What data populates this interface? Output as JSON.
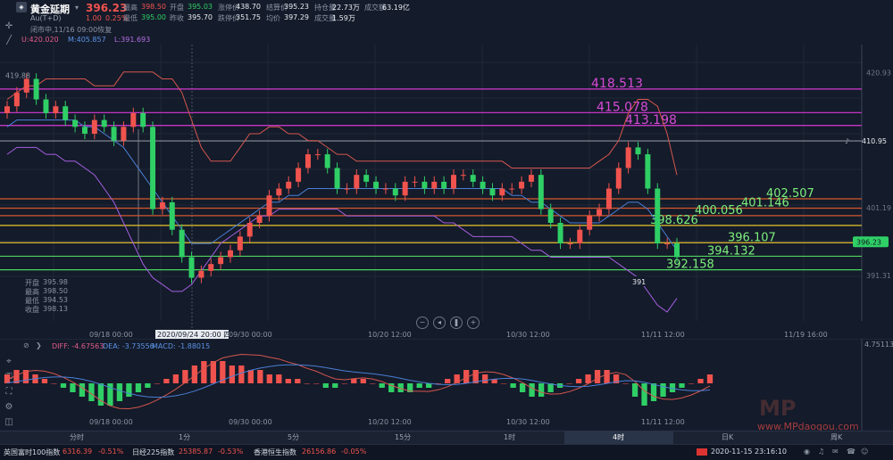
{
  "header": {
    "symbol_name": "黄金延期",
    "symbol_code": "Au(T+D)",
    "price": "396.23",
    "change": "1.00",
    "change_pct": "0.25%",
    "stats": [
      {
        "label": "最高",
        "value": "398.50",
        "color": "red"
      },
      {
        "label": "开盘",
        "value": "395.03",
        "color": "green"
      },
      {
        "label": "涨停价",
        "value": "438.70",
        "color": "white"
      },
      {
        "label": "结算价",
        "value": "395.23",
        "color": "white"
      },
      {
        "label": "持仓量",
        "value": "22.73万",
        "color": "white"
      },
      {
        "label": "成交额",
        "value": "63.19亿",
        "color": "white"
      },
      {
        "label": "最低",
        "value": "395.00",
        "color": "green"
      },
      {
        "label": "昨收",
        "value": "395.70",
        "color": "white"
      },
      {
        "label": "跌停价",
        "value": "351.75",
        "color": "white"
      },
      {
        "label": "均价",
        "value": "397.29",
        "color": "white"
      },
      {
        "label": "成交量",
        "value": "1.59万",
        "color": "white"
      }
    ],
    "status_line": "闭市中,11/16 09:00恢复",
    "boll": {
      "up": "U:420.020",
      "mid": "M:405.857",
      "low": "L:391.693"
    }
  },
  "ohlc_panel": [
    {
      "label": "开盘",
      "value": "395.98"
    },
    {
      "label": "最高",
      "value": "398.50"
    },
    {
      "label": "最低",
      "value": "394.53"
    },
    {
      "label": "收盘",
      "value": "398.13"
    }
  ],
  "chart_data": [
    {
      "type": "candlestick",
      "title": "",
      "ylim": [
        386,
        425
      ],
      "price_axis_labels": [
        "420.93",
        "410.95",
        "401.19",
        "396.23",
        "391.31"
      ],
      "left_axis_label": "419.88",
      "x_ticks": [
        "09/18 00:00",
        "2020/09/24 20:00 四",
        "09/30 00:00",
        "10/20 12:00",
        "10/30 12:00",
        "11/11 12:00",
        "11/19 16:00"
      ],
      "current_price": "396.23",
      "low_marker": "391",
      "levels": [
        {
          "value": 418.513,
          "label": "418.513",
          "color": "#d63ad6"
        },
        {
          "value": 415.078,
          "label": "415.078",
          "color": "#d63ad6"
        },
        {
          "value": 413.198,
          "label": "413.198",
          "color": "#d63ad6"
        },
        {
          "value": 410.95,
          "label": "",
          "color": "#8a8f99"
        },
        {
          "value": 402.507,
          "label": "402.507",
          "color": "#d2592e"
        },
        {
          "value": 401.146,
          "label": "401.146",
          "color": "#d2592e"
        },
        {
          "value": 400.056,
          "label": "400.056",
          "color": "#d2592e"
        },
        {
          "value": 398.626,
          "label": "398.626",
          "color": "#e6c42e"
        },
        {
          "value": 396.107,
          "label": "396.107",
          "color": "#e6c42e"
        },
        {
          "value": 394.132,
          "label": "394.132",
          "color": "#4cd460"
        },
        {
          "value": 392.158,
          "label": "392.158",
          "color": "#4cd460"
        }
      ],
      "series": [
        {
          "name": "close",
          "values": [
            416,
            418,
            420,
            417,
            415,
            416,
            414,
            413,
            412,
            414,
            413,
            411,
            413,
            415,
            413,
            401,
            402,
            398,
            394,
            391,
            392,
            393,
            394,
            395,
            397,
            399,
            400,
            403,
            404,
            405,
            407,
            409,
            409,
            407,
            404,
            404,
            406,
            405,
            404,
            404,
            403,
            405,
            405,
            404,
            405,
            404,
            406,
            406,
            405,
            404,
            403,
            404,
            404,
            405,
            406,
            401,
            399,
            396,
            396,
            398,
            400,
            401,
            404,
            407,
            410,
            409,
            404,
            396,
            396,
            394
          ]
        },
        {
          "name": "boll_upper",
          "values": [
            417,
            418,
            419,
            419,
            420,
            420,
            420,
            420,
            420,
            419,
            419,
            419,
            421,
            421,
            421,
            421,
            420,
            420,
            418,
            414,
            410,
            408,
            408,
            408,
            410,
            412,
            412,
            413,
            413,
            412,
            412,
            411,
            411,
            410,
            409,
            409,
            408,
            408,
            408,
            408,
            408,
            408,
            408,
            408,
            408,
            408,
            408,
            408,
            408,
            408,
            408,
            408,
            407,
            407,
            407,
            407,
            407,
            407,
            407,
            407,
            407,
            408,
            409,
            411,
            415,
            417,
            417,
            416,
            412,
            406
          ]
        },
        {
          "name": "boll_mid",
          "values": [
            413,
            414,
            414,
            414,
            414,
            414,
            414,
            414,
            413,
            413,
            412,
            411,
            410,
            408,
            406,
            404,
            402,
            400,
            398,
            396,
            396,
            396,
            397,
            398,
            399,
            400,
            401,
            402,
            402,
            403,
            403,
            404,
            404,
            404,
            404,
            404,
            404,
            404,
            404,
            404,
            404,
            404,
            404,
            404,
            404,
            404,
            404,
            404,
            404,
            404,
            404,
            404,
            403,
            403,
            402,
            402,
            401,
            400,
            399,
            399,
            399,
            399,
            400,
            401,
            402,
            402,
            401,
            399,
            397,
            395
          ]
        },
        {
          "name": "boll_lower",
          "values": [
            409,
            410,
            410,
            410,
            409,
            409,
            408,
            408,
            407,
            406,
            404,
            402,
            399,
            396,
            393,
            391,
            390,
            389,
            389,
            390,
            392,
            394,
            396,
            397,
            398,
            399,
            400,
            400,
            401,
            401,
            401,
            401,
            401,
            401,
            401,
            400,
            400,
            400,
            400,
            400,
            400,
            400,
            400,
            400,
            400,
            399,
            399,
            398,
            397,
            397,
            397,
            397,
            397,
            396,
            395,
            395,
            394,
            394,
            394,
            394,
            394,
            394,
            394,
            393,
            392,
            391,
            389,
            387,
            386,
            388
          ]
        }
      ]
    },
    {
      "type": "bar",
      "title": "",
      "indicator": "MACD",
      "legend": {
        "diff": "DIFF: -4.67563",
        "dea": "DEA: -3.73556",
        "macd": "MACD: -1.88015"
      },
      "axis_label": "4.75113",
      "x_ticks": [
        "09/18 00:00",
        "09/30 00:00",
        "10/20 12:00",
        "10/30 12:00",
        "11/11 12:00"
      ],
      "values": [
        2,
        3,
        3,
        2,
        1,
        0,
        -1,
        -2,
        -3,
        -4,
        -5,
        -5,
        -4,
        -3,
        -2,
        -1,
        0,
        1,
        2,
        3,
        4,
        5,
        5,
        5,
        4,
        4,
        3,
        3,
        2,
        2,
        1,
        1,
        0,
        0,
        -1,
        -1,
        0,
        1,
        1,
        0,
        -1,
        -2,
        -2,
        -2,
        -1,
        -1,
        0,
        1,
        2,
        3,
        3,
        2,
        1,
        0,
        -1,
        -2,
        -3,
        -3,
        -2,
        -1,
        0,
        1,
        2,
        3,
        3,
        2,
        0,
        -3,
        -5,
        -4,
        -3,
        -2,
        -1,
        0,
        1,
        2
      ]
    }
  ],
  "tabs": [
    "分时",
    "1分",
    "5分",
    "15分",
    "1时",
    "4时",
    "日K",
    "周K"
  ],
  "ticker": [
    {
      "name": "英国富时100指数",
      "value": "6316.39",
      "pct": "-0.51%",
      "color": "red"
    },
    {
      "name": "日经225指数",
      "value": "25385.87",
      "pct": "-0.53%",
      "color": "red"
    },
    {
      "name": "香港恒生指数",
      "value": "26156.86",
      "pct": "-0.05%",
      "color": "red"
    }
  ],
  "datetime": "2020-11-15 23:16:10",
  "watermark": {
    "brand": "MP",
    "domain": "www.MPdaogou.com"
  }
}
